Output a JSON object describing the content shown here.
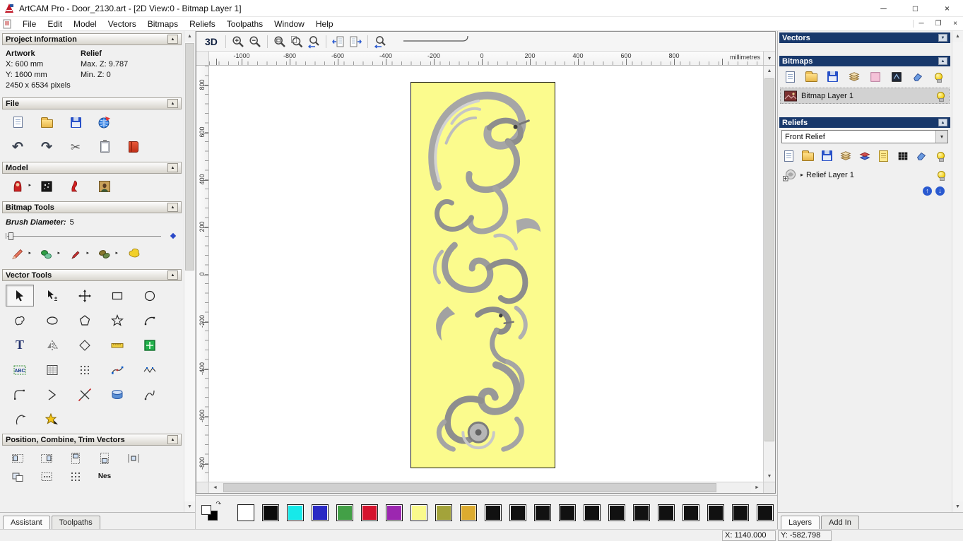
{
  "window": {
    "title": "ArtCAM Pro - Door_2130.art - [2D View:0 - Bitmap Layer 1]",
    "controls": {
      "minimize": "─",
      "maximize": "□",
      "close": "×"
    },
    "mdi": {
      "minimize": "─",
      "restore": "❐",
      "close": "×"
    }
  },
  "menubar": {
    "items": [
      {
        "label": "File"
      },
      {
        "label": "Edit"
      },
      {
        "label": "Model"
      },
      {
        "label": "Vectors"
      },
      {
        "label": "Bitmaps"
      },
      {
        "label": "Reliefs"
      },
      {
        "label": "Toolpaths"
      },
      {
        "label": "Window"
      },
      {
        "label": "Help"
      }
    ]
  },
  "icons": {
    "rollup": "▲",
    "collapse": "▲",
    "expand": "▼",
    "chevron_down": "▾",
    "dropdown": "▸",
    "scroll_up": "▲",
    "scroll_down": "▼",
    "scroll_left": "◄",
    "scroll_right": "►",
    "swap": "↷",
    "up": "↑",
    "down": "↓"
  },
  "assistant": {
    "project_info": {
      "title": "Project Information",
      "artwork_label": "Artwork",
      "relief_label": "Relief",
      "artwork_x": "X: 600 mm",
      "artwork_y": "Y: 1600 mm",
      "artwork_pixels": "2450 x 6534 pixels",
      "relief_max_z": "Max. Z: 9.787",
      "relief_min_z": "Min. Z: 0"
    },
    "file_section": {
      "title": "File",
      "row1": [
        {
          "name": "new-model-button",
          "icon": "new-page"
        },
        {
          "name": "open-model-button",
          "icon": "open-folder"
        },
        {
          "name": "save-model-button",
          "icon": "save-disk"
        },
        {
          "name": "export-model-button",
          "icon": "export-globe"
        }
      ],
      "row2": [
        {
          "name": "undo-button",
          "icon": "undo-arrow"
        },
        {
          "name": "redo-button",
          "icon": "redo-arrow"
        },
        {
          "name": "cut-button",
          "icon": "scissors"
        },
        {
          "name": "paste-button",
          "icon": "clipboard"
        },
        {
          "name": "notes-button",
          "icon": "notes-book"
        }
      ]
    },
    "model_section": {
      "title": "Model",
      "tools": [
        {
          "name": "front-relief-button",
          "icon": "front-figure",
          "dropdown": true
        },
        {
          "name": "greyscale-preview-button",
          "icon": "greyscale-preview"
        },
        {
          "name": "sculpting-button",
          "icon": "red-sculpt"
        },
        {
          "name": "load-image-button",
          "icon": "image-thumb"
        }
      ]
    },
    "bitmap_tools": {
      "title": "Bitmap Tools",
      "brush_label": "Brush Diameter:",
      "brush_value": "5",
      "tools": [
        {
          "name": "paint-tool",
          "icon": "pencil-red",
          "dropdown": true
        },
        {
          "name": "paint-selective-tool",
          "icon": "paint-selective",
          "dropdown": true
        },
        {
          "name": "draw-tool",
          "icon": "draw-colour",
          "dropdown": true
        },
        {
          "name": "colour-shading-tool",
          "icon": "beans",
          "dropdown": true
        },
        {
          "name": "flood-fill-tool",
          "icon": "flood-fill"
        }
      ]
    },
    "vector_tools": {
      "title": "Vector Tools",
      "tools": [
        {
          "name": "select-vectors-tool",
          "icon": "select-cursor",
          "active": true
        },
        {
          "name": "transform-vectors-tool",
          "icon": "transform-cursor"
        },
        {
          "name": "move-nudge-tool",
          "icon": "move-nudge"
        },
        {
          "name": "create-rectangle-tool",
          "icon": "rect-create"
        },
        {
          "name": "create-circle-tool",
          "icon": "circle-create"
        },
        {
          "name": "create-freehand-tool",
          "icon": "freehand-shape"
        },
        {
          "name": "create-ellipse-tool",
          "icon": "ellipse-create"
        },
        {
          "name": "create-polygon-tool",
          "icon": "polygon-create"
        },
        {
          "name": "create-star-tool",
          "icon": "star-create"
        },
        {
          "name": "create-arc-tool",
          "icon": "arc-create"
        },
        {
          "name": "create-text-tool",
          "icon": "text-tool"
        },
        {
          "name": "mirror-vectors-tool",
          "icon": "mirror-vectors"
        },
        {
          "name": "offset-vectors-tool",
          "icon": "offset-shape"
        },
        {
          "name": "measure-tool",
          "icon": "measure-ruler"
        },
        {
          "name": "block-copy-tool",
          "icon": "block-copy"
        },
        {
          "name": "wrap-text-abc-tool",
          "icon": "text-abc"
        },
        {
          "name": "text-in-frame-tool",
          "icon": "text-frame"
        },
        {
          "name": "paste-array-tool",
          "icon": "dots-array"
        },
        {
          "name": "fit-spline-tool",
          "icon": "node-edit"
        },
        {
          "name": "fit-polyline-tool",
          "icon": "wave-edit"
        },
        {
          "name": "create-fillet-tool",
          "icon": "fillet-tool"
        },
        {
          "name": "join-vectors-tool",
          "icon": "join-vectors"
        },
        {
          "name": "trim-vectors-tool",
          "icon": "trim-vectors"
        },
        {
          "name": "interactive-distort-tool",
          "icon": "extrude-disc"
        },
        {
          "name": "free-fillet-tool",
          "icon": "spline-tool"
        },
        {
          "name": "slice-tool",
          "icon": "slice-flag"
        },
        {
          "name": "paste-on-curve-tool",
          "icon": "star-wrap"
        }
      ]
    },
    "position_section": {
      "title": "Position, Combine, Trim Vectors",
      "row1": [
        {
          "name": "align-left-tool",
          "icon": "align-left"
        },
        {
          "name": "align-right-tool",
          "icon": "align-right"
        },
        {
          "name": "align-top-tool",
          "icon": "align-top"
        },
        {
          "name": "align-bottom-tool",
          "icon": "align-bottom"
        },
        {
          "name": "align-centre-tool",
          "icon": "align-center"
        }
      ],
      "row2": [
        {
          "name": "combine-vectors-tool",
          "icon": "overlap-box"
        },
        {
          "name": "distribute-vectors-tool",
          "icon": "dots-box"
        },
        {
          "name": "array-dots-tool",
          "icon": "dots-array"
        },
        {
          "name": "nest-vectors-tool",
          "text": "Nes"
        }
      ]
    },
    "tabs": [
      {
        "label": "Assistant",
        "active": true
      },
      {
        "label": "Toolpaths",
        "active": false
      }
    ]
  },
  "view_toolbar": {
    "button_3d": "3D",
    "zoom_tools": [
      {
        "name": "zoom-in-tool",
        "icon": "mag-plus"
      },
      {
        "name": "zoom-out-tool",
        "icon": "mag-minus"
      }
    ],
    "fit_tools": [
      {
        "name": "zoom-objects-tool",
        "icon": "mag-rect"
      },
      {
        "name": "zoom-fit-page-tool",
        "icon": "mag-page"
      },
      {
        "name": "zoom-previous-tool",
        "icon": "mag-prev"
      }
    ],
    "nav_tools": [
      {
        "name": "previous-view-button",
        "icon": "page-left"
      },
      {
        "name": "next-view-button",
        "icon": "page-right"
      }
    ],
    "extra_tools": [
      {
        "name": "zoom-back-tool",
        "icon": "mag-arrow"
      }
    ]
  },
  "rulers": {
    "horizontal": [
      "-1000",
      "-800",
      "-600",
      "-400",
      "-200",
      "0",
      "200",
      "400",
      "600",
      "800"
    ],
    "vertical": [
      "800",
      "600",
      "400",
      "200",
      "0",
      "-200",
      "-400",
      "-600",
      "-800"
    ],
    "units": "millimetres"
  },
  "layers_panel": {
    "vectors_title": "Vectors",
    "bitmaps_title": "Bitmaps",
    "bitmap_layer": "Bitmap Layer 1",
    "reliefs_title": "Reliefs",
    "relief_combo": "Front Relief",
    "relief_layer": "Relief Layer 1",
    "bitmaps_tools": [
      {
        "name": "new-bitmap-layer-button",
        "icon": "new-page"
      },
      {
        "name": "load-bitmap-layer-button",
        "icon": "open-folder"
      },
      {
        "name": "save-bitmap-layer-button",
        "icon": "save-disk"
      },
      {
        "name": "merge-bitmap-layers-button",
        "icon": "layer-stack"
      },
      {
        "name": "clear-bitmap-layer-button",
        "icon": "pink-square"
      },
      {
        "name": "greyscale-bitmap-button",
        "icon": "merge-dark"
      },
      {
        "name": "delete-bitmap-layer-button",
        "icon": "eraser-blue"
      },
      {
        "name": "toggle-bitmap-layers-button",
        "icon": "bulb"
      }
    ],
    "reliefs_tools": [
      {
        "name": "new-relief-layer-button",
        "icon": "new-page"
      },
      {
        "name": "load-relief-layer-button",
        "icon": "open-folder"
      },
      {
        "name": "save-relief-layer-button",
        "icon": "save-disk"
      },
      {
        "name": "merge-relief-layers-button",
        "icon": "layer-stack"
      },
      {
        "name": "transfer-relief-button",
        "icon": "stack-red-blue"
      },
      {
        "name": "relief-from-bitmap-button",
        "icon": "page-yellow"
      },
      {
        "name": "greyscale-relief-button",
        "icon": "grid-black"
      },
      {
        "name": "delete-relief-layer-button",
        "icon": "eraser-blue"
      },
      {
        "name": "toggle-relief-layers-button",
        "icon": "bulb"
      }
    ],
    "tabs": [
      {
        "label": "Layers",
        "active": true
      },
      {
        "label": "Add In",
        "active": false
      }
    ]
  },
  "palette": {
    "primary": "#ffffff",
    "secondary": "#000000",
    "colors": [
      "#ffffff",
      "#0a0a0a",
      "#17e9e9",
      "#2a2ac4",
      "#43a047",
      "#d5132e",
      "#9c27b0",
      "#fafa8c",
      "#a3a33a",
      "#dcab2f",
      "#111111",
      "#111111",
      "#111111",
      "#111111",
      "#111111",
      "#111111",
      "#111111",
      "#111111",
      "#111111",
      "#111111",
      "#111111",
      "#111111"
    ]
  },
  "statusbar": {
    "x_value": "X: 1140.000",
    "y_value": "Y: -582.798"
  }
}
